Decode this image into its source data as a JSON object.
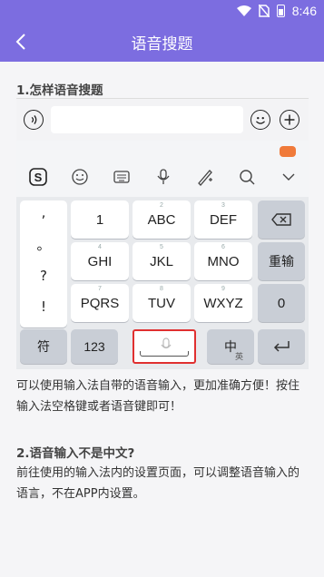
{
  "status": {
    "time": "8:46"
  },
  "header": {
    "title": "语音搜题"
  },
  "q1": {
    "title": "1.怎样语音搜题"
  },
  "ime": {
    "keys": {
      "punct": [
        ",",
        "。",
        "?",
        "!"
      ],
      "row1": [
        "1",
        "ABC",
        "DEF"
      ],
      "row1_num": [
        "",
        "2",
        "3"
      ],
      "row2": [
        "GHI",
        "JKL",
        "MNO"
      ],
      "row2_num": [
        "4",
        "5",
        "6"
      ],
      "row3": [
        "PQRS",
        "TUV",
        "WXYZ"
      ],
      "row3_num": [
        "7",
        "8",
        "9"
      ],
      "redo": "重输",
      "zero": "0",
      "sym": "符",
      "num123": "123",
      "cn": "中",
      "cn_sub": "英"
    }
  },
  "p1": "可以使用输入法自带的语音输入，更加准确方便！按住输入法空格键或者语音键即可！",
  "q2": {
    "title": "2.语音输入不是中文?"
  },
  "p2": "前往使用的输入法内的设置页面，可以调整语音输入的语言，不在APP内设置。"
}
